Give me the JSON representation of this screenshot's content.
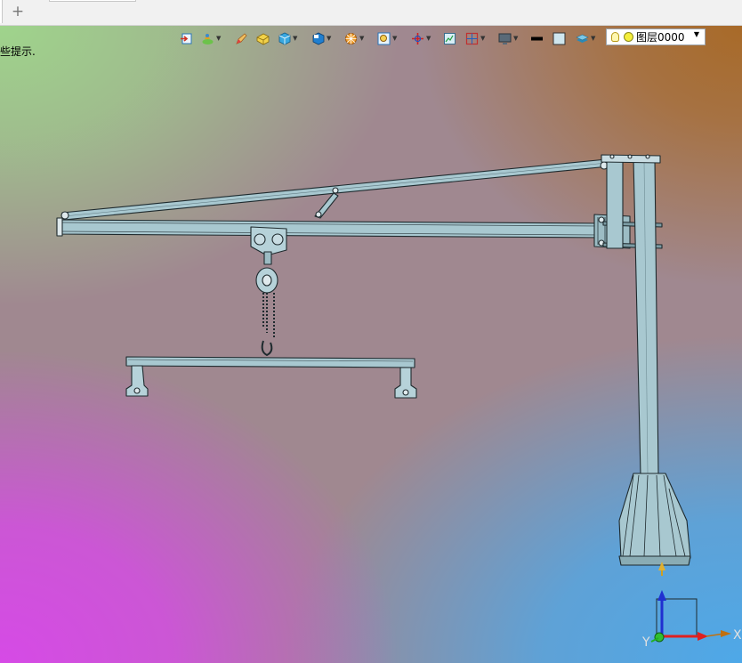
{
  "tabs": {
    "new_tab_symbol": "+"
  },
  "viewport": {
    "hint_text": "些提示.",
    "toolbar": {
      "icons": [
        "exit-sketch-icon",
        "render-mode-icon",
        "pencil-edit-icon",
        "cheese-block-icon",
        "solid-cube-icon",
        "view-box-icon",
        "section-wheel-icon",
        "zoom-fit-icon",
        "move-axes-icon",
        "frame-icon",
        "split-view-icon",
        "monitor-display-icon",
        "line-style-icon",
        "color-swatch-icon",
        "layer-stack-icon"
      ],
      "layer_value": "图层0000"
    },
    "triad": {
      "x_label": "X",
      "y_label": "Y"
    }
  },
  "colors": {
    "steel": "#a8c8d0",
    "steel_edge": "#1e2a2e",
    "axis_x": "#e02020",
    "axis_y": "#20b020",
    "axis_z": "#2030d0"
  }
}
